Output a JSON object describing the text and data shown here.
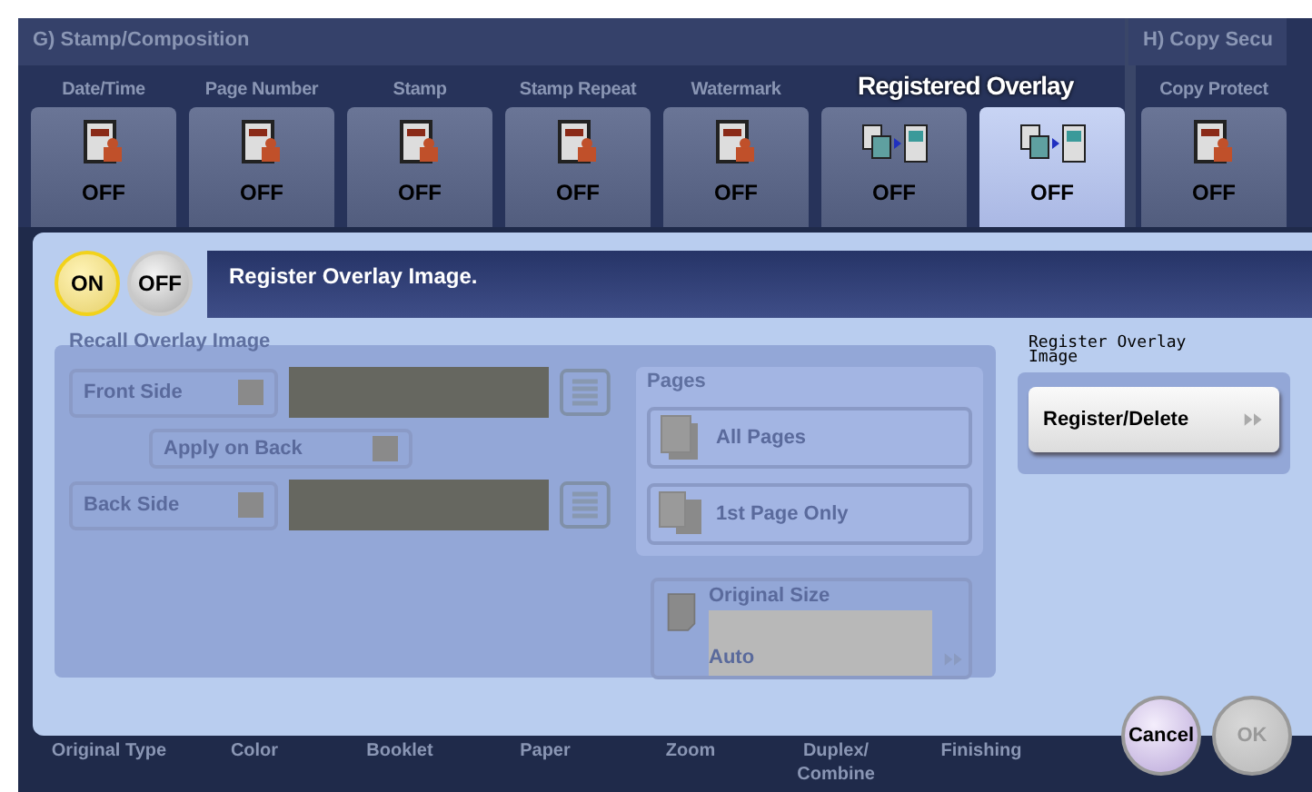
{
  "groups": [
    {
      "title": "G)  Stamp/Composition",
      "tabs": [
        {
          "label": "Date/Time",
          "value": "OFF",
          "selected": false
        },
        {
          "label": "Page Number",
          "value": "OFF",
          "selected": false
        },
        {
          "label": "Stamp",
          "value": "OFF",
          "selected": false
        },
        {
          "label": "Stamp Repeat",
          "value": "OFF",
          "selected": false
        },
        {
          "label": "Watermark",
          "value": "OFF",
          "selected": false
        },
        {
          "kind": "overlay",
          "value": "OFF",
          "selected": false
        },
        {
          "kind": "overlay",
          "value": "OFF",
          "selected": true
        }
      ]
    },
    {
      "title": "H)  Copy Secu",
      "tabs": [
        {
          "label": "Copy Protect",
          "value": "OFF",
          "selected": false
        }
      ]
    }
  ],
  "tooltip": "Registered Overlay",
  "dialog": {
    "toggle": [
      {
        "label": "ON",
        "selected": true
      },
      {
        "label": "OFF",
        "selected": false
      }
    ],
    "message": "Register Overlay Image.",
    "recall": {
      "title": "Recall Overlay Image",
      "disabled": true,
      "front": {
        "label": "Front Side"
      },
      "apply_on_back": {
        "label": "Apply on Back"
      },
      "back": {
        "label": "Back Side"
      },
      "pages": {
        "title": "Pages",
        "options": [
          {
            "label": "All Pages"
          },
          {
            "label": "1st Page Only"
          }
        ]
      },
      "original_size": {
        "label": "Original Size",
        "value": "Auto"
      }
    },
    "register": {
      "title": "Register Overlay Image",
      "button": "Register/Delete"
    }
  },
  "bottom_tabs": [
    {
      "label": "Original Type"
    },
    {
      "label": "Color"
    },
    {
      "label": "Booklet"
    },
    {
      "label": "Paper"
    },
    {
      "label": "Zoom"
    },
    {
      "label": "Duplex/\nCombine"
    },
    {
      "label": "Finishing"
    }
  ],
  "actions": [
    {
      "label": "Cancel",
      "disabled": false
    },
    {
      "label": "OK",
      "disabled": true
    }
  ]
}
